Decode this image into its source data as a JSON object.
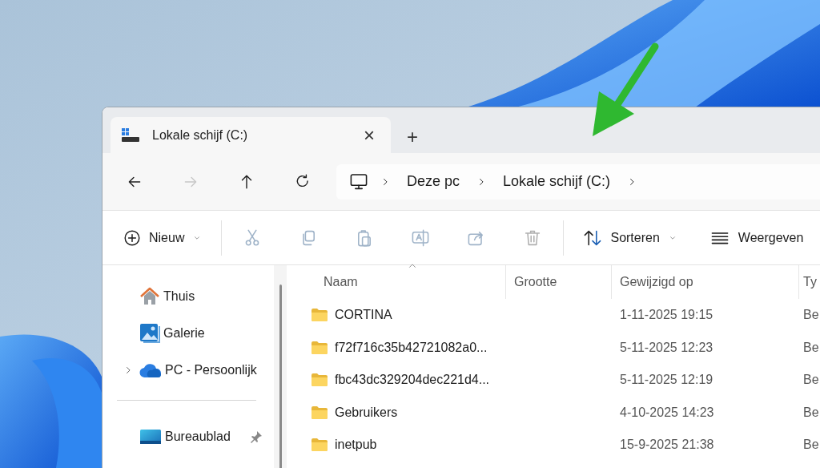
{
  "window": {
    "tabs": [
      {
        "title": "Lokale schijf (C:)",
        "selected": true,
        "close": "×"
      }
    ],
    "new_tab": "+"
  },
  "nav": {
    "buttons": [
      {
        "kind": "back",
        "disabled": false
      },
      {
        "kind": "forward",
        "disabled": true
      },
      {
        "kind": "up",
        "disabled": false
      },
      {
        "kind": "refresh",
        "disabled": false
      }
    ],
    "breadcrumb": [
      "Deze pc",
      "Lokale schijf (C:)"
    ]
  },
  "toolbar": {
    "new": {
      "label": "Nieuw"
    },
    "actions": [
      {
        "kind": "cut",
        "disabled": true
      },
      {
        "kind": "copy",
        "disabled": true
      },
      {
        "kind": "paste",
        "disabled": true
      },
      {
        "kind": "rename",
        "disabled": true
      },
      {
        "kind": "share",
        "disabled": true
      },
      {
        "kind": "delete",
        "disabled": true
      }
    ],
    "sort": {
      "label": "Sorteren"
    },
    "view": {
      "label": "Weergeven"
    }
  },
  "sidebar": {
    "items": [
      {
        "kind": "home",
        "label": "Thuis"
      },
      {
        "kind": "gallery",
        "label": "Galerie"
      },
      {
        "kind": "cloud",
        "label": "PC - Persoonlijk",
        "expanded": false
      },
      {
        "kind": "separator"
      },
      {
        "kind": "desktop",
        "label": "Bureaublad",
        "pinned": true
      }
    ]
  },
  "file_list": {
    "columns": [
      "Naam",
      "Grootte",
      "Gewijzigd op",
      "Ty"
    ],
    "rows": [
      {
        "name": "CORTINA",
        "modified": "1-11-2025 19:15",
        "column_4": "Be"
      },
      {
        "name": "f72f716c35b42721082a0...",
        "modified": "5-11-2025 12:23",
        "column_4": "Be"
      },
      {
        "name": "fbc43dc329204dec221d4...",
        "modified": "5-11-2025 12:19",
        "column_4": "Be"
      },
      {
        "name": "Gebruikers",
        "modified": "4-10-2025 14:23",
        "column_4": "Be"
      },
      {
        "name": "inetpub",
        "modified": "15-9-2025 21:38",
        "column_4": "Be"
      }
    ]
  }
}
